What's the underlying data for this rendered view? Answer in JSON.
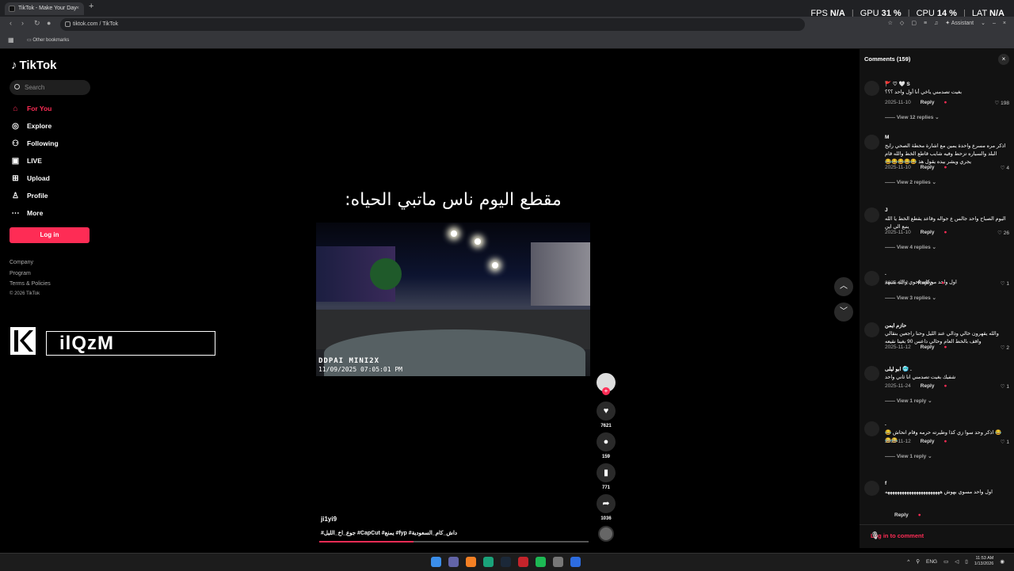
{
  "browser": {
    "tab_title": "TikTok - Make Your Day",
    "tab_close": "×",
    "new_tab": "+",
    "url": "tiktok.com / TikTok",
    "assistant_label": "Assistant",
    "bookmarks_label": "Other bookmarks"
  },
  "perf_overlay": {
    "fps_label": "FPS",
    "fps_value": "N/A",
    "gpu_label": "GPU",
    "gpu_value": "31",
    "gpu_unit": "%",
    "cpu_label": "CPU",
    "cpu_value": "14",
    "cpu_unit": "%",
    "lat_label": "LAT",
    "lat_value": "N/A"
  },
  "sidebar": {
    "logo_text": "TikTok",
    "search_placeholder": "Search",
    "items": [
      {
        "label": "For You",
        "icon": "home-icon",
        "active": true
      },
      {
        "label": "Explore",
        "icon": "compass-icon",
        "active": false
      },
      {
        "label": "Following",
        "icon": "following-icon",
        "active": false
      },
      {
        "label": "LIVE",
        "icon": "live-icon",
        "active": false
      },
      {
        "label": "Upload",
        "icon": "upload-icon",
        "active": false
      },
      {
        "label": "Profile",
        "icon": "profile-icon",
        "active": false
      },
      {
        "label": "More",
        "icon": "more-icon",
        "active": false
      }
    ],
    "login_label": "Log in",
    "footer": [
      "Company",
      "Program",
      "Terms & Policies",
      "© 2026 TikTok"
    ]
  },
  "watermark": {
    "text": "ilQzM"
  },
  "video": {
    "title_caption": "مقطع اليوم ناس ماتبي الحياه:",
    "dashcam_brand": "DDPAI MINI2X",
    "dashcam_timestamp": "11/09/2025 07:05:01 PM",
    "username": "ji1yi9",
    "hashtags": "#جوع_اخ_الليل #CapCut #يمنع #fyp #داش_كام_السعودية",
    "progress": 0.35
  },
  "actions": {
    "likes": "7621",
    "comments": "159",
    "saves": "771",
    "shares": "1036"
  },
  "comments_panel": {
    "header": "Comments",
    "count": "(159)",
    "close": "×",
    "login_prompt": "Log in to comment",
    "reply_label": "Reply",
    "items": [
      {
        "name": "🚩 ♡ 🤍 S",
        "text": "بغيت تصدمني ياخي أنا أول واحد ؟؟؟",
        "date": "2025-11-10",
        "likes": "198",
        "view_replies": "View 12 replies"
      },
      {
        "name": "M",
        "text": "اذكر مره مسرع واحدة يمين مع اشارة محطة الصحي رايح البلد والسياره تزحط وفيه شايب قاطع الخط والله قام يجري ويشر بيده يقول هذ 😂😂😂😂😂",
        "date": "2025-11-10",
        "likes": "4",
        "view_replies": "View 2 replies"
      },
      {
        "name": "J",
        "text": "اليوم الصباح واحد جالس ع جواله وقاعد يقطع الخط يا الله ينبع الى اين",
        "date": "2025-11-10",
        "likes": "26",
        "view_replies": "View 4 replies"
      },
      {
        "name": ".",
        "text": "اول واحد مو كانه احوي والله شبهه",
        "date": "2025-12-2",
        "likes": "1",
        "view_replies": "View 3 replies"
      },
      {
        "name": "حازم ايمن",
        "text": "والله يقهرون خالي ودالي عند الليل وحنا راجعين بنقالي واقف بالخط العام وحالي داعس 90 بغينا نقيعه",
        "date": "2025-11-12",
        "likes": "2",
        "view_replies": ""
      },
      {
        "name": "ابو ليلى 🥶 .",
        "text": "شفيك بغيت تصدمني انا ثاني واحد",
        "date": "2025-11-24",
        "likes": "1",
        "view_replies": "View 1 reply"
      },
      {
        "name": ".",
        "text": "😂 اذكر وحد سوا زي كذا وطيرته حرمه وقام انحاش 😂😂😂",
        "date": "2025-11-12",
        "likes": "1",
        "view_replies": "View 1 reply"
      },
      {
        "name": "f",
        "text": "اول واحد مسوي بهوش هههههههههههههههههههههههه",
        "date": "",
        "likes": "",
        "view_replies": ""
      }
    ]
  },
  "taskbar": {
    "lang": "ENG",
    "time": "11:53 AM",
    "date": "1/13/2026",
    "apps": [
      "windows-start-icon",
      "teams-icon",
      "vlc-icon",
      "edge-icon",
      "steam-icon",
      "app-red-icon",
      "spotify-icon",
      "settings-icon",
      "app-blue-icon"
    ]
  }
}
